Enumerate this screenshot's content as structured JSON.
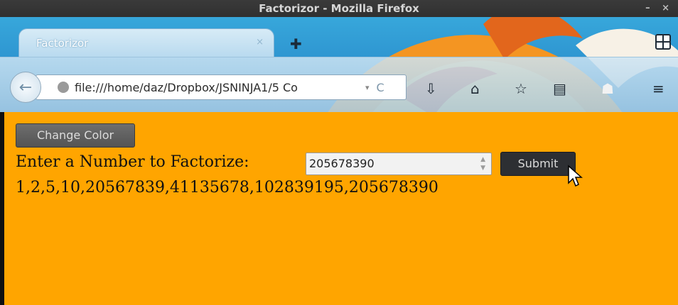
{
  "window": {
    "title": "Factorizor - Mozilla Firefox",
    "controls": "– ×"
  },
  "tab": {
    "title": "Factorizor",
    "close": "×",
    "new_tab": "✚"
  },
  "navbar": {
    "url": "file:///home/daz/Dropbox/JSNINJA1/5 Co",
    "dropdown": "▾",
    "reload": "C",
    "icons": [
      "download-icon",
      "home-icon",
      "bookmark-star-icon",
      "reading-list-icon",
      "ghost-addon-icon",
      "menu-icon"
    ]
  },
  "page": {
    "background": "#ffa500",
    "change_color_label": "Change Color",
    "prompt": "Enter a Number to Factorize:",
    "number_value": "205678390",
    "submit_label": "Submit",
    "result": "1,2,5,10,20567839,41135678,102839195,205678390"
  }
}
